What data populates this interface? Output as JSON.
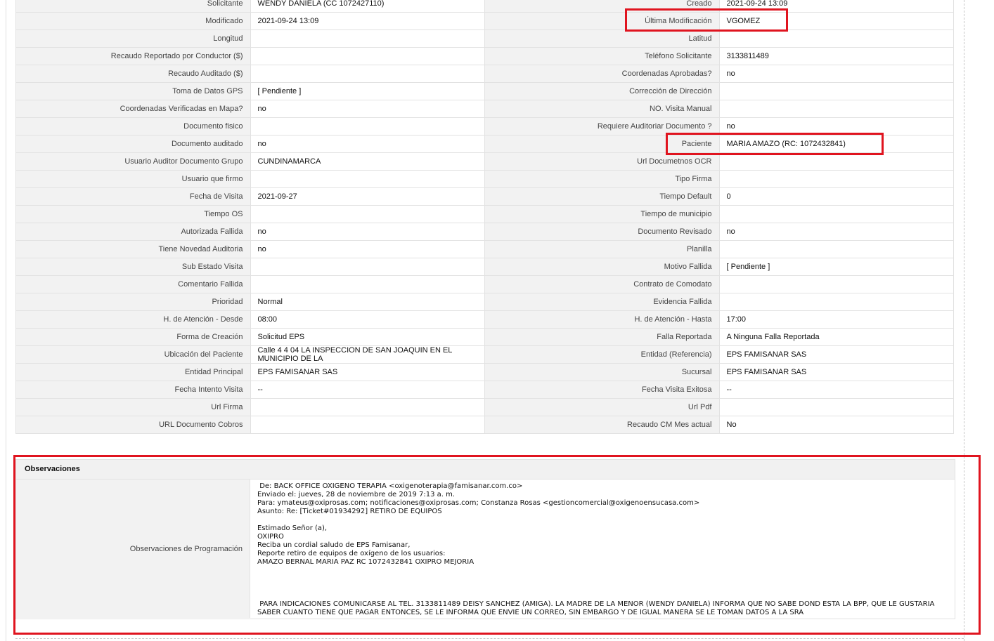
{
  "rows": [
    {
      "l1": "Solicitante",
      "v1": "WENDY DANIELA (CC 1072427110)",
      "l2": "Creado",
      "v2": "2021-09-24 13:09"
    },
    {
      "l1": "Modificado",
      "v1": "2021-09-24 13:09",
      "l2": "Última Modificación",
      "v2": "VGOMEZ"
    },
    {
      "l1": "Longitud",
      "v1": "",
      "l2": "Latitud",
      "v2": ""
    },
    {
      "l1": "Recaudo Reportado por Conductor ($)",
      "v1": "",
      "l2": "Teléfono Solicitante",
      "v2": "3133811489"
    },
    {
      "l1": "Recaudo Auditado ($)",
      "v1": "",
      "l2": "Coordenadas Aprobadas?",
      "v2": "no"
    },
    {
      "l1": "Toma de Datos GPS",
      "v1": "[ Pendiente ]",
      "l2": "Corrección de Dirección",
      "v2": ""
    },
    {
      "l1": "Coordenadas Verificadas en Mapa?",
      "v1": "no",
      "l2": "NO. Visita Manual",
      "v2": ""
    },
    {
      "l1": "Documento fisico",
      "v1": "",
      "l2": "Requiere Auditoriar Documento ?",
      "v2": "no"
    },
    {
      "l1": "Documento auditado",
      "v1": "no",
      "l2": "Paciente",
      "v2": "MARIA AMAZO (RC: 1072432841)"
    },
    {
      "l1": "Usuario Auditor Documento Grupo",
      "v1": "CUNDINAMARCA",
      "l2": "Url Documetnos OCR",
      "v2": ""
    },
    {
      "l1": "Usuario que firmo",
      "v1": "",
      "l2": "Tipo Firma",
      "v2": ""
    },
    {
      "l1": "Fecha de Visita",
      "v1": "2021-09-27",
      "l2": "Tiempo Default",
      "v2": "0"
    },
    {
      "l1": "Tiempo OS",
      "v1": "",
      "l2": "Tiempo de municipio",
      "v2": ""
    },
    {
      "l1": "Autorizada Fallida",
      "v1": "no",
      "l2": "Documento Revisado",
      "v2": "no"
    },
    {
      "l1": "Tiene Novedad Auditoria",
      "v1": "no",
      "l2": "Planilla",
      "v2": ""
    },
    {
      "l1": "Sub Estado Visita",
      "v1": "",
      "l2": "Motivo Fallida",
      "v2": "[ Pendiente ]"
    },
    {
      "l1": "Comentario Fallida",
      "v1": "",
      "l2": "Contrato de Comodato",
      "v2": ""
    },
    {
      "l1": "Prioridad",
      "v1": "Normal",
      "l2": "Evidencia Fallida",
      "v2": ""
    },
    {
      "l1": "H. de Atención - Desde",
      "v1": "08:00",
      "l2": "H. de Atención - Hasta",
      "v2": "17:00"
    },
    {
      "l1": "Forma de Creación",
      "v1": "Solicitud EPS",
      "l2": "Falla Reportada",
      "v2": "A Ninguna Falla Reportada"
    },
    {
      "l1": "Ubicación del Paciente",
      "v1": "Calle 4 4 04 LA INSPECCION DE SAN JOAQUIN EN EL MUNICIPIO DE LA",
      "l2": "Entidad (Referencia)",
      "v2": "EPS FAMISANAR SAS"
    },
    {
      "l1": "Entidad Principal",
      "v1": "EPS FAMISANAR SAS",
      "l2": "Sucursal",
      "v2": "EPS FAMISANAR SAS"
    },
    {
      "l1": "Fecha Intento Visita",
      "v1": "--",
      "l2": "Fecha Visita Exitosa",
      "v2": "--"
    },
    {
      "l1": "Url Firma",
      "v1": "",
      "l2": "Url Pdf",
      "v2": ""
    },
    {
      "l1": "URL Documento Cobros",
      "v1": "",
      "l2": "Recaudo CM Mes actual",
      "v2": "No"
    }
  ],
  "observaciones": {
    "heading": "Observaciones",
    "label": "Observaciones de Programación",
    "text": " De: BACK OFFICE OXIGENO TERAPIA <oxigenoterapia@famisanar.com.co>\nEnviado el: jueves, 28 de noviembre de 2019 7:13 a. m.\nPara: ymateus@oxiprosas.com; notificaciones@oxiprosas.com; Constanza Rosas <gestioncomercial@oxigenoensucasa.com>\nAsunto: Re: [Ticket#01934292] RETIRO DE EQUIPOS\n\nEstimado Señor (a),\nOXIPRO\nReciba un cordial saludo de EPS Famisanar,\nReporte retiro de equipos de oxígeno de los usuarios:\nAMAZO BERNAL MARIA PAZ RC 1072432841 OXIPRO MEJORIA\n\n\n\n\n PARA INDICACIONES COMUNICARSE AL TEL. 3133811489 DEISY SANCHEZ (AMIGA). LA MADRE DE LA MENOR (WENDY DANIELA) INFORMA QUE NO SABE DOND ESTA LA BPP, QUE LE GUSTARIA SABER CUANTO TIENE QUE PAGAR ENTONCES, SE LE INFORMA QUE ENVIE UN CORREO, SIN EMBARGO Y DE IGUAL MANERA SE LE TOMAN DATOS A LA SRA"
  },
  "colors": {
    "highlight": "#e0141f",
    "label_bg": "#f2f2f2",
    "border": "#e2e2e2"
  }
}
